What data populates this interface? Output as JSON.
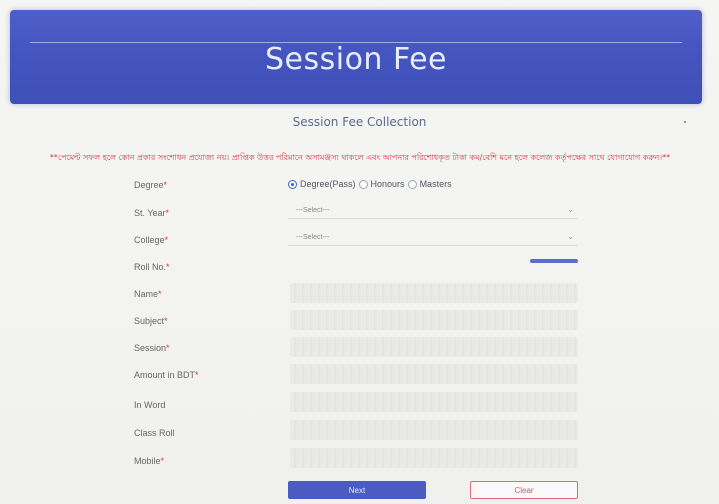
{
  "header": {
    "title": "Session Fee"
  },
  "form": {
    "section_title": "Session Fee Collection",
    "notice": "**পেমেন্ট সফল হলে কোন প্রকার সংশোধন প্রযোজ্য নয়। প্রাপ্তিক উত্তর পরিমানে অসামঞ্জস্য থাকলে এবং আপনার পরিশোধকৃত টাকা কম/বেশি মনে হলে কলেজ কর্তৃপক্ষের সাথে যোগাযোগ করুন।**",
    "fields": {
      "degree": {
        "label": "Degree",
        "required": "*"
      },
      "st_year": {
        "label": "St. Year",
        "required": "*"
      },
      "college": {
        "label": "College",
        "required": "*"
      },
      "roll_no": {
        "label": "Roll No.",
        "required": "*"
      },
      "name": {
        "label": "Name",
        "required": "*"
      },
      "subject": {
        "label": "Subject",
        "required": "*"
      },
      "session": {
        "label": "Session",
        "required": "*"
      },
      "amount": {
        "label": "Amount in BDT",
        "required": "*"
      },
      "in_word": {
        "label": "In Word",
        "required": ""
      },
      "class_roll": {
        "label": "Class Roll",
        "required": ""
      },
      "mobile": {
        "label": "Mobile",
        "required": "*"
      }
    },
    "degree_options": {
      "pass": "Degree(Pass)",
      "honours": "Honours",
      "masters": "Masters",
      "selected": "Degree(Pass)"
    },
    "st_year_placeholder": "---Select---",
    "college_placeholder": "---Select---",
    "next_label": "Next",
    "clear_label": "Clear"
  },
  "colors": {
    "banner": "#4656c0",
    "required": "#d8344a",
    "next_button": "#4a5cc2",
    "clear_border": "#d46a7c"
  },
  "icons": {
    "select_arrow": "chevron-down-icon",
    "radio_checked": "radio-checked-icon",
    "radio_unchecked": "radio-unchecked-icon"
  }
}
